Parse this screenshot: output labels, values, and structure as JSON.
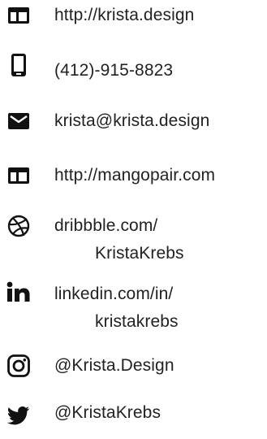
{
  "contacts": {
    "website": {
      "text": "http://krista.design",
      "icon": "browser-window-icon"
    },
    "phone": {
      "text": "(412)-915-8823",
      "icon": "smartphone-icon"
    },
    "email": {
      "text": "krista@krista.design",
      "icon": "envelope-icon"
    },
    "website2": {
      "text": "http://mangopair.com",
      "icon": "browser-window-icon"
    },
    "dribbble": {
      "line1": "dribbble.com/",
      "line2": "KristaKrebs",
      "icon": "dribbble-icon"
    },
    "linkedin": {
      "line1": "linkedin.com/in/",
      "line2": "kristakrebs",
      "icon": "linkedin-icon"
    },
    "instagram": {
      "text": "@Krista.Design",
      "icon": "instagram-icon"
    },
    "twitter": {
      "text": "@KristaKrebs",
      "icon": "twitter-icon"
    }
  },
  "colors": {
    "icon": "#111111",
    "text": "#222222",
    "background": "#ffffff"
  }
}
